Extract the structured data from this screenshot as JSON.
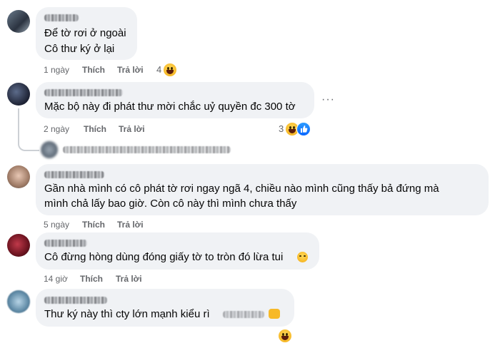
{
  "comments": [
    {
      "text_lines": [
        "Để tờ rơi ở ngoài",
        "Cô thư ký ở lại"
      ],
      "time": "1 ngày",
      "like_label": "Thích",
      "reply_label": "Trả lời",
      "reaction_count": "4",
      "reactions": [
        "haha-emoji"
      ]
    },
    {
      "text_lines": [
        "Mặc bộ này đi phát thư mời chắc uỷ quyền đc 300 tờ"
      ],
      "time": "2 ngày",
      "like_label": "Thích",
      "reply_label": "Trả lời",
      "reaction_count": "3",
      "reactions": [
        "haha-emoji",
        "like-icon"
      ],
      "more_label": "···"
    },
    {
      "text_lines": [
        "Gần nhà mình có cô phát tờ rơi ngay ngã 4, chiều nào mình cũng thấy bả đứng mà",
        "mình chả lấy bao giờ. Còn cô này thì mình chưa thấy"
      ],
      "time": "5 ngày",
      "like_label": "Thích",
      "reply_label": "Trả lời"
    },
    {
      "text_lines": [
        "Cô đừng hòng dùng đóng giấy tờ to tròn đó lừa tui"
      ],
      "time": "14 giờ",
      "like_label": "Thích",
      "reply_label": "Trả lời"
    },
    {
      "text_lines": [
        "Thư ký này thì cty lớn mạnh kiểu rì"
      ],
      "reactions": [
        "haha-emoji"
      ]
    }
  ],
  "colors": {
    "bubble": "#f0f2f5",
    "meta_text": "#65676b",
    "body_text": "#050505",
    "like_blue": "#0866ff",
    "emoji_yellow": "#f7b928"
  }
}
